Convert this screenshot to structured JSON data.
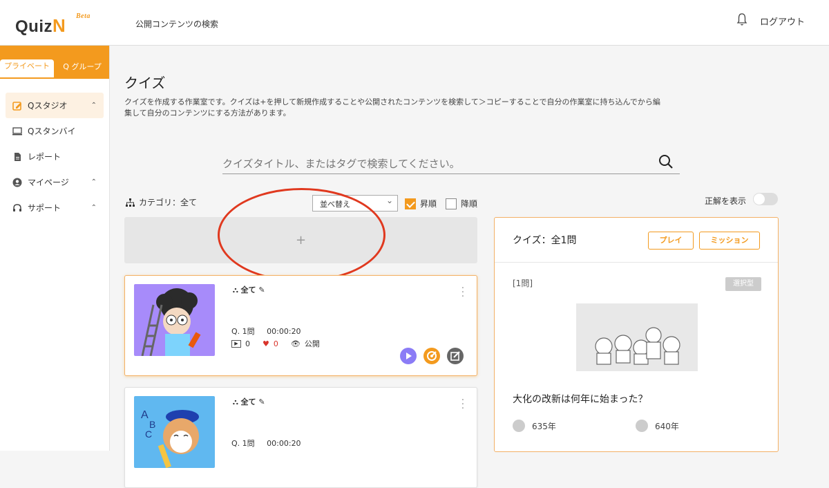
{
  "header": {
    "logo_text": "Quiz",
    "logo_n": "N",
    "logo_beta": "Beta",
    "search_link": "公開コンテンツの検索",
    "logout": "ログアウト"
  },
  "sidebar": {
    "tabs": [
      "プライベート",
      "Q グループ"
    ],
    "items": [
      {
        "label": "Qスタジオ",
        "icon": "edit-icon"
      },
      {
        "label": "Qスタンバイ",
        "icon": "monitor-icon"
      },
      {
        "label": "レポート",
        "icon": "document-icon"
      },
      {
        "label": "マイページ",
        "icon": "user-icon"
      },
      {
        "label": "サポート",
        "icon": "headset-icon"
      }
    ]
  },
  "main": {
    "title": "クイズ",
    "description": "クイズを作成する作業室です。クイズは+を押して新規作成することや公開されたコンテンツを検索して＞コピーすることで自分の作業室に持ち込んでから編集して自分のコンテンツにする方法があります。",
    "search_placeholder": "クイズタイトル、またはタグで検索してください。",
    "category": "カテゴリ：全て",
    "sort_label": "並べ替え",
    "asc_label": "昇順",
    "desc_label": "降順",
    "show_answer": "正解を表示",
    "add_symbol": "+"
  },
  "cards": [
    {
      "category": "全て",
      "questions": "Q. 1問",
      "time": "00:00:20",
      "plays": "0",
      "likes": "0",
      "visibility": "公開"
    },
    {
      "category": "全て",
      "questions": "Q. 1問",
      "time": "00:00:20"
    }
  ],
  "panel": {
    "title": "クイズ：全1問",
    "play_button": "プレイ",
    "mission_button": "ミッション",
    "question_number": "[1問]",
    "question_type": "選択型",
    "question_text": "大化の改新は何年に始まった？",
    "options": [
      "635年",
      "640年"
    ]
  },
  "colors": {
    "accent": "#f39a1e",
    "annotation": "#e0391f"
  }
}
